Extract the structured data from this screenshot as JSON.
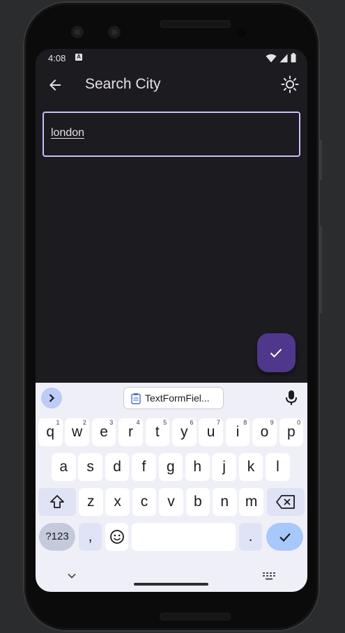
{
  "status_bar": {
    "time": "4:08",
    "notification_badge": "A"
  },
  "app_bar": {
    "title": "Search City",
    "back_icon": "arrow-back-icon",
    "theme_icon": "sun-icon"
  },
  "search_field": {
    "value": "london"
  },
  "fab": {
    "icon": "check-icon"
  },
  "keyboard": {
    "suggestion": "TextFormFiel...",
    "rows": [
      [
        {
          "k": "q",
          "h": "1"
        },
        {
          "k": "w",
          "h": "2"
        },
        {
          "k": "e",
          "h": "3"
        },
        {
          "k": "r",
          "h": "4"
        },
        {
          "k": "t",
          "h": "5"
        },
        {
          "k": "y",
          "h": "6"
        },
        {
          "k": "u",
          "h": "7"
        },
        {
          "k": "i",
          "h": "8"
        },
        {
          "k": "o",
          "h": "9"
        },
        {
          "k": "p",
          "h": "0"
        }
      ],
      [
        {
          "k": "a"
        },
        {
          "k": "s"
        },
        {
          "k": "d"
        },
        {
          "k": "f"
        },
        {
          "k": "g"
        },
        {
          "k": "h"
        },
        {
          "k": "j"
        },
        {
          "k": "k"
        },
        {
          "k": "l"
        }
      ],
      [
        {
          "k": "z"
        },
        {
          "k": "x"
        },
        {
          "k": "c"
        },
        {
          "k": "v"
        },
        {
          "k": "b"
        },
        {
          "k": "n"
        },
        {
          "k": "m"
        }
      ]
    ],
    "symbols_label": "?123",
    "comma_label": ",",
    "period_label": ".",
    "icons": [
      "chevron-right-icon",
      "clipboard-icon",
      "mic-icon",
      "shift-icon",
      "backspace-icon",
      "emoji-icon",
      "enter-check-icon",
      "chevron-down-icon",
      "keyboard-icon"
    ]
  },
  "colors": {
    "background": "#1c1b1f",
    "accent_border": "#d0bcff",
    "fab": "#4f378b",
    "keyboard_bg": "#eff0f7",
    "enter_key": "#a8c7fa"
  }
}
